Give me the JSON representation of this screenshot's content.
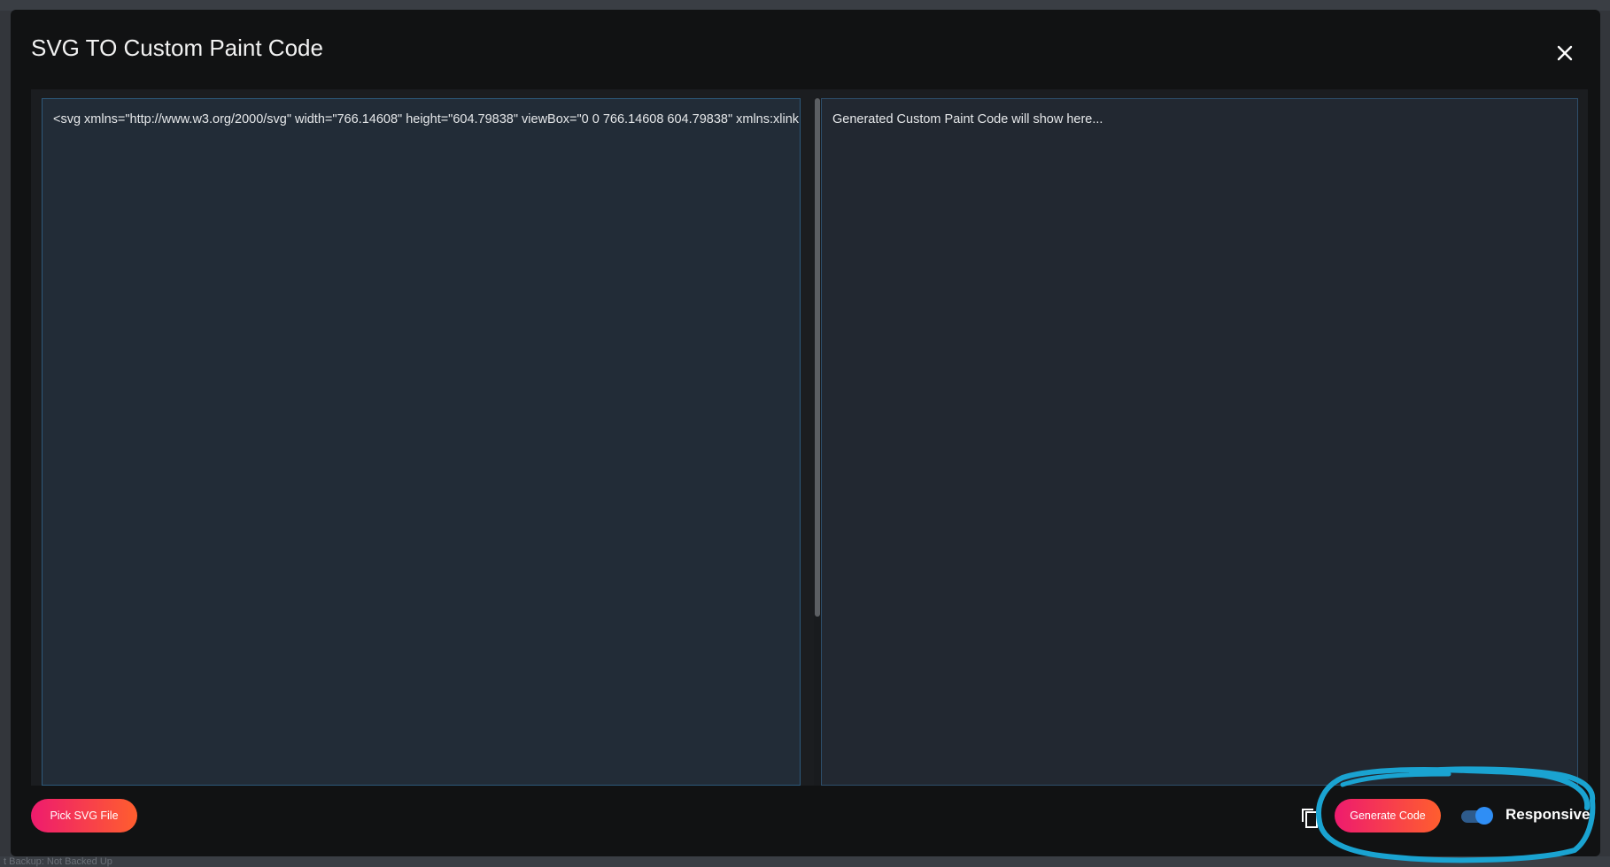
{
  "dialog": {
    "title": "SVG TO Custom Paint Code",
    "close_icon": "close-icon"
  },
  "input_editor": {
    "value": "<svg xmlns=\"http://www.w3.org/2000/svg\" width=\"766.14608\" height=\"604.79838\" viewBox=\"0 0 766.14608 604.79838\" xmlns:xlink"
  },
  "output_editor": {
    "placeholder": "Generated Custom Paint Code will show here..."
  },
  "footer": {
    "pick_label": "Pick SVG File",
    "generate_label": "Generate Code",
    "copy_icon": "copy-icon",
    "toggle_label": "Responsive",
    "toggle_on": true
  },
  "background": {
    "status_text": "t Backup:  Not Backed Up"
  },
  "colors": {
    "accent_gradient_start": "#ee1b6e",
    "accent_gradient_end": "#ff5e2e",
    "toggle_accent": "#2f8ef5",
    "annotation": "#1aa3d1"
  }
}
